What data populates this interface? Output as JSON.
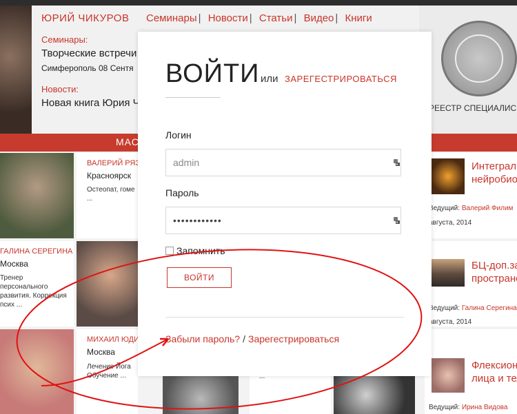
{
  "header": {
    "brand": "ЮРИЙ ЧИКУРОВ",
    "nav": [
      "Семинары",
      "Новости",
      "Статьи",
      "Видео",
      "Книги"
    ],
    "seminars_label": "Семинары:",
    "seminar_title": "Творческие встречи",
    "seminar_sub": "Симферополь 08 Сентя",
    "news_label": "Новости:",
    "news_title": "Новая книга Юрия Ч",
    "registry": "РЕЕСТР СПЕЦИАЛИС"
  },
  "banner": {
    "text": "МАС"
  },
  "cards": [
    {
      "name": "ВАЛЕРИЙ РЯЗА",
      "city": "Красноярск",
      "desc": "Остеопат, гоме\n..."
    },
    {
      "name": "ГАЛИНА СЕРЕГИНА",
      "city": "Москва",
      "desc": "Тренер\nперсонального\nразвития. Коррекция\nпсих ..."
    },
    {
      "name": "МИХАИЛ ЮДИН",
      "city": "Москва",
      "desc": "Лечение Йога\nОбучение ..."
    },
    {
      "extra": "..."
    }
  ],
  "news": [
    {
      "title1": "Интеграл",
      "title2": "нейробио",
      "meta_prefix": "Ведущий: ",
      "author": "Валерий Филим",
      "date": "августа, 2014"
    },
    {
      "title1": "БЦ-доп.за",
      "title2": "пространс",
      "meta_prefix": "Ведущий: ",
      "author": "Галина Серегина",
      "date": "августа, 2014"
    },
    {
      "title1": "Флексион",
      "title2": "лица и тел",
      "meta_prefix": "Ведущий: ",
      "author": "Ирина Видова",
      "date": ""
    }
  ],
  "modal": {
    "title": "ВОЙТИ",
    "or": "или",
    "register_link": "ЗАРЕГЕСТРИРОВАТЬСЯ",
    "login_label": "Логин",
    "login_value": "admin",
    "password_label": "Пароль",
    "password_value": "••••••••••••",
    "remember_label": "Запомнить",
    "submit_label": "ВОЙТИ",
    "forgot_link": "Забыли пароль?",
    "slash": "/",
    "register_bottom": "Зарегестрироваться"
  },
  "icons": {
    "field_icon": "key-icon",
    "annotation": "red-ellipse-arrow"
  },
  "colors": {
    "accent": "#c8352a",
    "banner": "#c63b2d"
  }
}
